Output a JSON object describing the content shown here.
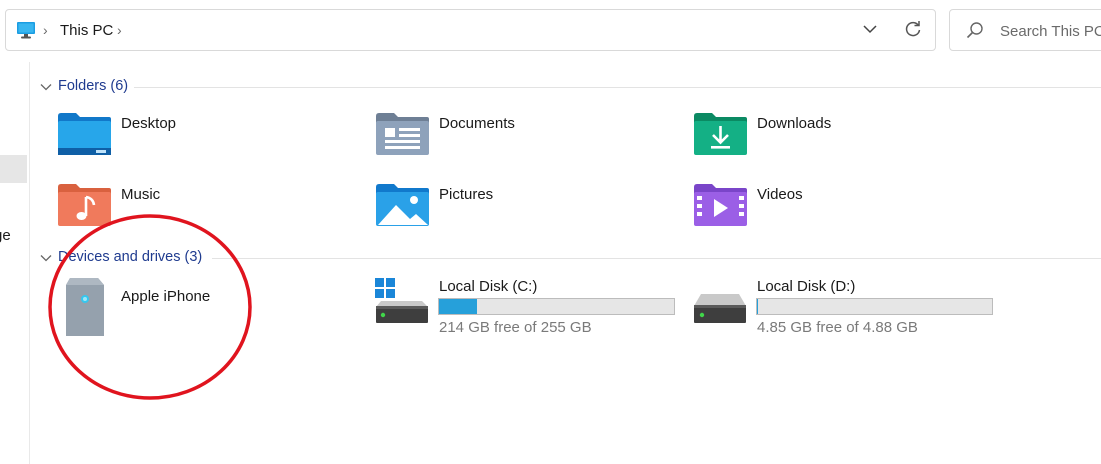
{
  "address_bar": {
    "location": "This PC"
  },
  "search": {
    "placeholder": "Search This PC"
  },
  "nav_pane": {
    "partial_item_text": "ge"
  },
  "folders_group": {
    "header": "Folders (6)",
    "items": [
      {
        "label": "Desktop",
        "icon": "desktop-folder-icon"
      },
      {
        "label": "Documents",
        "icon": "documents-folder-icon"
      },
      {
        "label": "Downloads",
        "icon": "downloads-folder-icon"
      },
      {
        "label": "Music",
        "icon": "music-folder-icon"
      },
      {
        "label": "Pictures",
        "icon": "pictures-folder-icon"
      },
      {
        "label": "Videos",
        "icon": "videos-folder-icon"
      }
    ]
  },
  "devices_group": {
    "header": "Devices and drives (3)",
    "items": [
      {
        "label": "Apple iPhone",
        "icon": "portable-device-icon"
      },
      {
        "label": "Local Disk (C:)",
        "icon": "windows-drive-icon",
        "free_text": "214 GB free of 255 GB",
        "used_fraction": 0.16
      },
      {
        "label": "Local Disk (D:)",
        "icon": "drive-icon",
        "free_text": "4.85 GB free of 4.88 GB",
        "used_fraction": 0.006
      }
    ]
  },
  "annotation": {
    "shape": "ellipse",
    "color": "#e0141e"
  },
  "colors": {
    "accent": "#26a0da",
    "group_header": "#1f3b8f"
  }
}
